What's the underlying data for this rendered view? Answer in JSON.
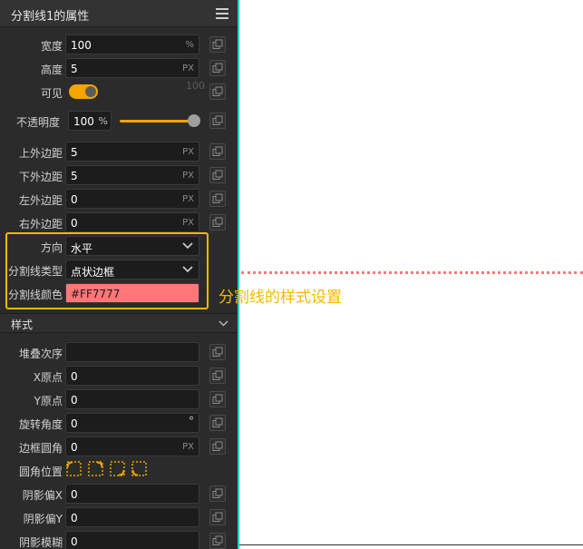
{
  "panel": {
    "title": "分割线1的属性"
  },
  "fields": {
    "width": {
      "label": "宽度",
      "value": "100",
      "unit": "%"
    },
    "height": {
      "label": "高度",
      "value": "5",
      "unit": "PX"
    },
    "visible": {
      "label": "可见",
      "ghost": "100"
    },
    "opacity": {
      "label": "不透明度",
      "value": "100",
      "unit": "%",
      "level_percent": 100
    },
    "margin_top": {
      "label": "上外边距",
      "value": "5",
      "unit": "PX"
    },
    "margin_bottom": {
      "label": "下外边距",
      "value": "5",
      "unit": "PX"
    },
    "margin_left": {
      "label": "左外边距",
      "value": "0",
      "unit": "PX"
    },
    "margin_right": {
      "label": "右外边距",
      "value": "0",
      "unit": "PX"
    },
    "direction": {
      "label": "方向",
      "value": "水平"
    },
    "line_type": {
      "label": "分割线类型",
      "value": "点状边框"
    },
    "line_color": {
      "label": "分割线颜色",
      "value": "#FF7777"
    }
  },
  "style_section": {
    "title": "样式",
    "z_index": {
      "label": "堆叠次序",
      "value": ""
    },
    "origin_x": {
      "label": "X原点",
      "value": "0"
    },
    "origin_y": {
      "label": "Y原点",
      "value": "0"
    },
    "rotation": {
      "label": "旋转角度",
      "value": "0",
      "unit": "°"
    },
    "border_radius": {
      "label": "边框圆角",
      "value": "0",
      "unit": "PX"
    },
    "corner_position": {
      "label": "圆角位置"
    },
    "shadow_x": {
      "label": "阴影偏X",
      "value": "0"
    },
    "shadow_y": {
      "label": "阴影偏Y",
      "value": "0"
    },
    "shadow_blur": {
      "label": "阴影模糊",
      "value": "0"
    }
  },
  "canvas": {
    "annotation": "分割线的样式设置"
  },
  "colors": {
    "accent": "#f5a400",
    "highlight": "#f5b800",
    "divider": "#ff7777",
    "panel_bg": "#2b2b2b"
  }
}
